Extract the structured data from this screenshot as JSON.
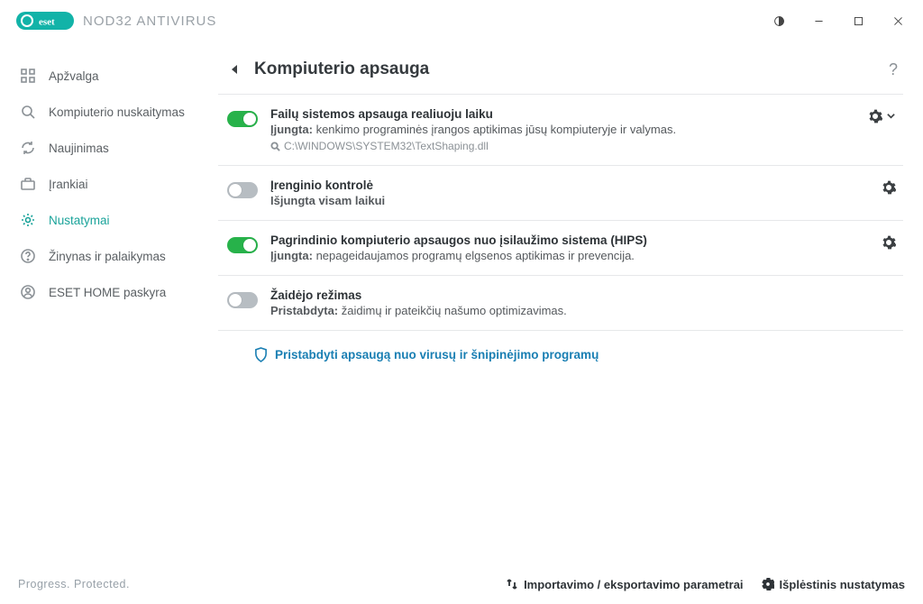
{
  "brand": {
    "product": "NOD32 ANTIVIRUS"
  },
  "window": {
    "theme_icon": "theme-contrast-icon",
    "minimize": "−",
    "maximize": "□",
    "close": "×"
  },
  "sidebar": {
    "items": [
      {
        "label": "Apžvalga",
        "icon": "dashboard-icon"
      },
      {
        "label": "Kompiuterio nuskaitymas",
        "icon": "search-icon"
      },
      {
        "label": "Naujinimas",
        "icon": "refresh-icon"
      },
      {
        "label": "Įrankiai",
        "icon": "briefcase-icon"
      },
      {
        "label": "Nustatymai",
        "icon": "gear-icon"
      },
      {
        "label": "Žinynas ir palaikymas",
        "icon": "help-icon"
      },
      {
        "label": "ESET HOME paskyra",
        "icon": "user-icon"
      }
    ],
    "active_index": 4
  },
  "page": {
    "title": "Kompiuterio apsauga",
    "help": "?"
  },
  "settings": [
    {
      "title": "Failų sistemos apsauga realiuoju laiku",
      "state_label": "Įjungta:",
      "description": "kenkimo programinės įrangos aptikimas jūsų kompiuteryje ir valymas.",
      "path": "C:\\WINDOWS\\SYSTEM32\\TextShaping.dll",
      "toggle": "on",
      "has_chevron": true
    },
    {
      "title": "Įrenginio kontrolė",
      "state_label": "Išjungta visam laikui",
      "description": "",
      "toggle": "off",
      "has_chevron": false
    },
    {
      "title": "Pagrindinio kompiuterio apsaugos nuo įsilaužimo sistema (HIPS)",
      "state_label": "Įjungta:",
      "description": "nepageidaujamos programų elgsenos aptikimas ir prevencija.",
      "toggle": "on",
      "has_chevron": false
    },
    {
      "title": "Žaidėjo režimas",
      "state_label": "Pristabdyta:",
      "description": "žaidimų ir pateikčių našumo optimizavimas.",
      "toggle": "off",
      "has_chevron": false
    }
  ],
  "pause_link": "Pristabdyti apsaugą nuo virusų ir šnipinėjimo programų",
  "footer": {
    "tagline": "Progress. Protected.",
    "import_export": "Importavimo / eksportavimo parametrai",
    "advanced": "Išplėstinis nustatymas"
  }
}
